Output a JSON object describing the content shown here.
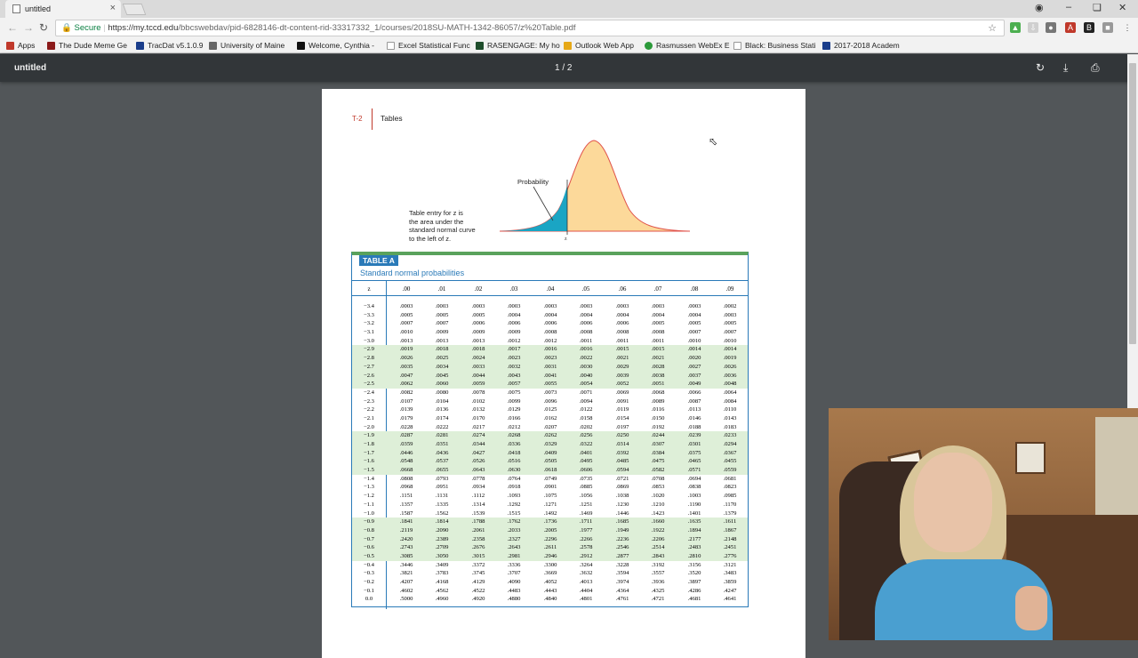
{
  "browser": {
    "tab_title": "untitled",
    "tab_close": "×",
    "secure_label": "Secure",
    "url_host": "https://my.tccd.edu",
    "url_path": "/bbcswebdav/pid-6828146-dt-content-rid-33317332_1/courses/2018SU-MATH-1342-86057/z%20Table.pdf",
    "bookmarks": [
      {
        "label": "Apps",
        "color": "#c0392b"
      },
      {
        "label": "The Dude Meme Ge",
        "color": "#8b1a1a"
      },
      {
        "label": "TracDat v5.1.0.9",
        "color": "#1a3d8b"
      },
      {
        "label": "University of Maine",
        "color": "#666666"
      },
      {
        "label": "Welcome, Cynthia -",
        "color": "#111111"
      },
      {
        "label": "Excel Statistical Func",
        "color": "#999999"
      },
      {
        "label": "RASENGAGE: My ho",
        "color": "#1e4d2b"
      },
      {
        "label": "Outlook Web App",
        "color": "#e6a817"
      },
      {
        "label": "Rasmussen WebEx E",
        "color": "#2c9a3a"
      },
      {
        "label": "Black: Business Stati",
        "color": "#999999"
      },
      {
        "label": "2017-2018 Academ",
        "color": "#1a3d8b"
      }
    ]
  },
  "pdf": {
    "title": "untitled",
    "page_indicator": "1 / 2"
  },
  "page": {
    "header_code": "T-2",
    "header_title": "Tables",
    "probability_label": "Probability",
    "caption_lines": [
      "Table entry for z is",
      "the area under the",
      "standard normal curve",
      "to the left of z."
    ],
    "z_tick_label": "z",
    "table_badge": "TABLE A",
    "table_subtitle": "Standard normal probabilities",
    "columns": [
      "z",
      ".00",
      ".01",
      ".02",
      ".03",
      ".04",
      ".05",
      ".06",
      ".07",
      ".08",
      ".09"
    ],
    "rows": [
      [
        "−3.4",
        ".0003",
        ".0003",
        ".0003",
        ".0003",
        ".0003",
        ".0003",
        ".0003",
        ".0003",
        ".0003",
        ".0002"
      ],
      [
        "−3.3",
        ".0005",
        ".0005",
        ".0005",
        ".0004",
        ".0004",
        ".0004",
        ".0004",
        ".0004",
        ".0004",
        ".0003"
      ],
      [
        "−3.2",
        ".0007",
        ".0007",
        ".0006",
        ".0006",
        ".0006",
        ".0006",
        ".0006",
        ".0005",
        ".0005",
        ".0005"
      ],
      [
        "−3.1",
        ".0010",
        ".0009",
        ".0009",
        ".0009",
        ".0008",
        ".0008",
        ".0008",
        ".0008",
        ".0007",
        ".0007"
      ],
      [
        "−3.0",
        ".0013",
        ".0013",
        ".0013",
        ".0012",
        ".0012",
        ".0011",
        ".0011",
        ".0011",
        ".0010",
        ".0010"
      ],
      [
        "−2.9",
        ".0019",
        ".0018",
        ".0018",
        ".0017",
        ".0016",
        ".0016",
        ".0015",
        ".0015",
        ".0014",
        ".0014"
      ],
      [
        "−2.8",
        ".0026",
        ".0025",
        ".0024",
        ".0023",
        ".0023",
        ".0022",
        ".0021",
        ".0021",
        ".0020",
        ".0019"
      ],
      [
        "−2.7",
        ".0035",
        ".0034",
        ".0033",
        ".0032",
        ".0031",
        ".0030",
        ".0029",
        ".0028",
        ".0027",
        ".0026"
      ],
      [
        "−2.6",
        ".0047",
        ".0045",
        ".0044",
        ".0043",
        ".0041",
        ".0040",
        ".0039",
        ".0038",
        ".0037",
        ".0036"
      ],
      [
        "−2.5",
        ".0062",
        ".0060",
        ".0059",
        ".0057",
        ".0055",
        ".0054",
        ".0052",
        ".0051",
        ".0049",
        ".0048"
      ],
      [
        "−2.4",
        ".0082",
        ".0080",
        ".0078",
        ".0075",
        ".0073",
        ".0071",
        ".0069",
        ".0068",
        ".0066",
        ".0064"
      ],
      [
        "−2.3",
        ".0107",
        ".0104",
        ".0102",
        ".0099",
        ".0096",
        ".0094",
        ".0091",
        ".0089",
        ".0087",
        ".0084"
      ],
      [
        "−2.2",
        ".0139",
        ".0136",
        ".0132",
        ".0129",
        ".0125",
        ".0122",
        ".0119",
        ".0116",
        ".0113",
        ".0110"
      ],
      [
        "−2.1",
        ".0179",
        ".0174",
        ".0170",
        ".0166",
        ".0162",
        ".0158",
        ".0154",
        ".0150",
        ".0146",
        ".0143"
      ],
      [
        "−2.0",
        ".0228",
        ".0222",
        ".0217",
        ".0212",
        ".0207",
        ".0202",
        ".0197",
        ".0192",
        ".0188",
        ".0183"
      ],
      [
        "−1.9",
        ".0287",
        ".0281",
        ".0274",
        ".0268",
        ".0262",
        ".0256",
        ".0250",
        ".0244",
        ".0239",
        ".0233"
      ],
      [
        "−1.8",
        ".0359",
        ".0351",
        ".0344",
        ".0336",
        ".0329",
        ".0322",
        ".0314",
        ".0307",
        ".0301",
        ".0294"
      ],
      [
        "−1.7",
        ".0446",
        ".0436",
        ".0427",
        ".0418",
        ".0409",
        ".0401",
        ".0392",
        ".0384",
        ".0375",
        ".0367"
      ],
      [
        "−1.6",
        ".0548",
        ".0537",
        ".0526",
        ".0516",
        ".0505",
        ".0495",
        ".0485",
        ".0475",
        ".0465",
        ".0455"
      ],
      [
        "−1.5",
        ".0668",
        ".0655",
        ".0643",
        ".0630",
        ".0618",
        ".0606",
        ".0594",
        ".0582",
        ".0571",
        ".0559"
      ],
      [
        "−1.4",
        ".0808",
        ".0793",
        ".0778",
        ".0764",
        ".0749",
        ".0735",
        ".0721",
        ".0708",
        ".0694",
        ".0681"
      ],
      [
        "−1.3",
        ".0968",
        ".0951",
        ".0934",
        ".0918",
        ".0901",
        ".0885",
        ".0869",
        ".0853",
        ".0838",
        ".0823"
      ],
      [
        "−1.2",
        ".1151",
        ".1131",
        ".1112",
        ".1093",
        ".1075",
        ".1056",
        ".1038",
        ".1020",
        ".1003",
        ".0985"
      ],
      [
        "−1.1",
        ".1357",
        ".1335",
        ".1314",
        ".1292",
        ".1271",
        ".1251",
        ".1230",
        ".1210",
        ".1190",
        ".1170"
      ],
      [
        "−1.0",
        ".1587",
        ".1562",
        ".1539",
        ".1515",
        ".1492",
        ".1469",
        ".1446",
        ".1423",
        ".1401",
        ".1379"
      ],
      [
        "−0.9",
        ".1841",
        ".1814",
        ".1788",
        ".1762",
        ".1736",
        ".1711",
        ".1685",
        ".1660",
        ".1635",
        ".1611"
      ],
      [
        "−0.8",
        ".2119",
        ".2090",
        ".2061",
        ".2033",
        ".2005",
        ".1977",
        ".1949",
        ".1922",
        ".1894",
        ".1867"
      ],
      [
        "−0.7",
        ".2420",
        ".2389",
        ".2358",
        ".2327",
        ".2296",
        ".2266",
        ".2236",
        ".2206",
        ".2177",
        ".2148"
      ],
      [
        "−0.6",
        ".2743",
        ".2709",
        ".2676",
        ".2643",
        ".2611",
        ".2578",
        ".2546",
        ".2514",
        ".2483",
        ".2451"
      ],
      [
        "−0.5",
        ".3085",
        ".3050",
        ".3015",
        ".2981",
        ".2946",
        ".2912",
        ".2877",
        ".2843",
        ".2810",
        ".2776"
      ],
      [
        "−0.4",
        ".3446",
        ".3409",
        ".3372",
        ".3336",
        ".3300",
        ".3264",
        ".3228",
        ".3192",
        ".3156",
        ".3121"
      ],
      [
        "−0.3",
        ".3821",
        ".3783",
        ".3745",
        ".3707",
        ".3669",
        ".3632",
        ".3594",
        ".3557",
        ".3520",
        ".3483"
      ],
      [
        "−0.2",
        ".4207",
        ".4168",
        ".4129",
        ".4090",
        ".4052",
        ".4013",
        ".3974",
        ".3936",
        ".3897",
        ".3859"
      ],
      [
        "−0.1",
        ".4602",
        ".4562",
        ".4522",
        ".4483",
        ".4443",
        ".4404",
        ".4364",
        ".4325",
        ".4286",
        ".4247"
      ],
      [
        "0.0",
        ".5000",
        ".4960",
        ".4920",
        ".4880",
        ".4840",
        ".4801",
        ".4761",
        ".4721",
        ".4681",
        ".4641"
      ]
    ]
  },
  "colors": {
    "accent_blue": "#2a7ab8",
    "accent_green": "#5aa25c",
    "shade_green": "#deefd8",
    "curve_fill": "#fcd99a",
    "tail_fill": "#1aa5c4",
    "curve_stroke": "#e0524a"
  }
}
